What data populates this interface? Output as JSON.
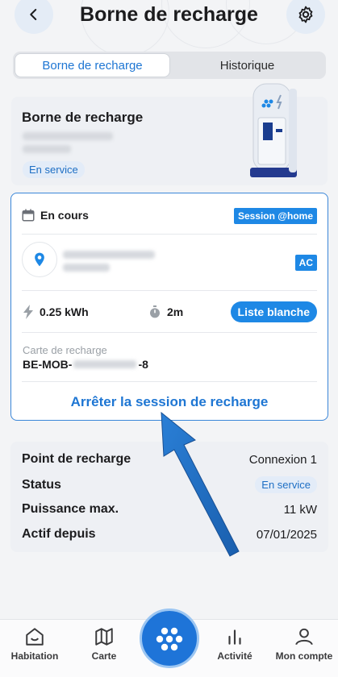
{
  "header": {
    "title": "Borne de recharge"
  },
  "segments": {
    "active": "Borne de recharge",
    "inactive": "Historique"
  },
  "station": {
    "title": "Borne de recharge",
    "status": "En service"
  },
  "session": {
    "status": "En cours",
    "tag": "Session @home",
    "current_type": "AC",
    "energy": "0.25 kWh",
    "duration": "2m",
    "list_button": "Liste blanche",
    "card_label": "Carte de recharge",
    "card_prefix": "BE-MOB-",
    "card_suffix": "-8",
    "stop_label": "Arrêter la session de recharge"
  },
  "details": {
    "rows": [
      {
        "key": "Point de recharge",
        "value": "Connexion 1"
      },
      {
        "key": "Status",
        "value": "En service"
      },
      {
        "key": "Puissance max.",
        "value": "11 kW"
      },
      {
        "key": "Actif depuis",
        "value": "07/01/2025"
      }
    ]
  },
  "tabbar": {
    "home": "Habitation",
    "map": "Carte",
    "activity": "Activité",
    "account": "Mon compte"
  },
  "colors": {
    "accent": "#1e88e5",
    "link": "#1e76d3",
    "badge_bg": "#e3ecf8"
  },
  "icons": [
    "back-arrow-icon",
    "gear-icon",
    "calendar-icon",
    "location-pin-icon",
    "bolt-icon",
    "timer-icon",
    "home-icon",
    "map-icon",
    "grid-dots-icon",
    "bar-chart-icon",
    "user-icon"
  ]
}
